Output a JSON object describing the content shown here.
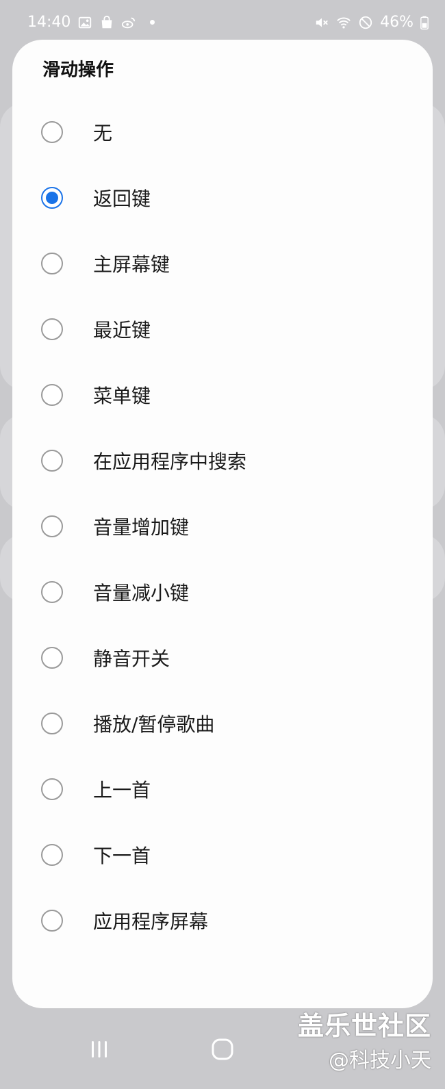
{
  "status_bar": {
    "time": "14:40",
    "battery": "46%",
    "left_icons": [
      "gallery-icon",
      "shopping-bag-icon",
      "weibo-icon",
      "notification-dot-icon"
    ],
    "right_icons": [
      "mute-icon",
      "wifi-icon",
      "do-not-disturb-icon",
      "battery-icon"
    ]
  },
  "dialog": {
    "title": "滑动操作",
    "options": [
      {
        "label": "无",
        "selected": false
      },
      {
        "label": "返回键",
        "selected": true
      },
      {
        "label": "主屏幕键",
        "selected": false
      },
      {
        "label": "最近键",
        "selected": false
      },
      {
        "label": "菜单键",
        "selected": false
      },
      {
        "label": "在应用程序中搜索",
        "selected": false
      },
      {
        "label": "音量增加键",
        "selected": false
      },
      {
        "label": "音量减小键",
        "selected": false
      },
      {
        "label": "静音开关",
        "selected": false
      },
      {
        "label": "播放/暂停歌曲",
        "selected": false
      },
      {
        "label": "上一首",
        "selected": false
      },
      {
        "label": "下一首",
        "selected": false
      },
      {
        "label": "应用程序屏幕",
        "selected": false
      }
    ]
  },
  "watermark": {
    "line1": "盖乐世社区",
    "line2": "@科技小天"
  },
  "colors": {
    "accent": "#1a73e8",
    "dialog_bg": "#fdfdfd",
    "scrim": "#c9c9cc"
  },
  "nav_bar": {
    "icons": [
      "recents-icon",
      "home-icon"
    ]
  }
}
